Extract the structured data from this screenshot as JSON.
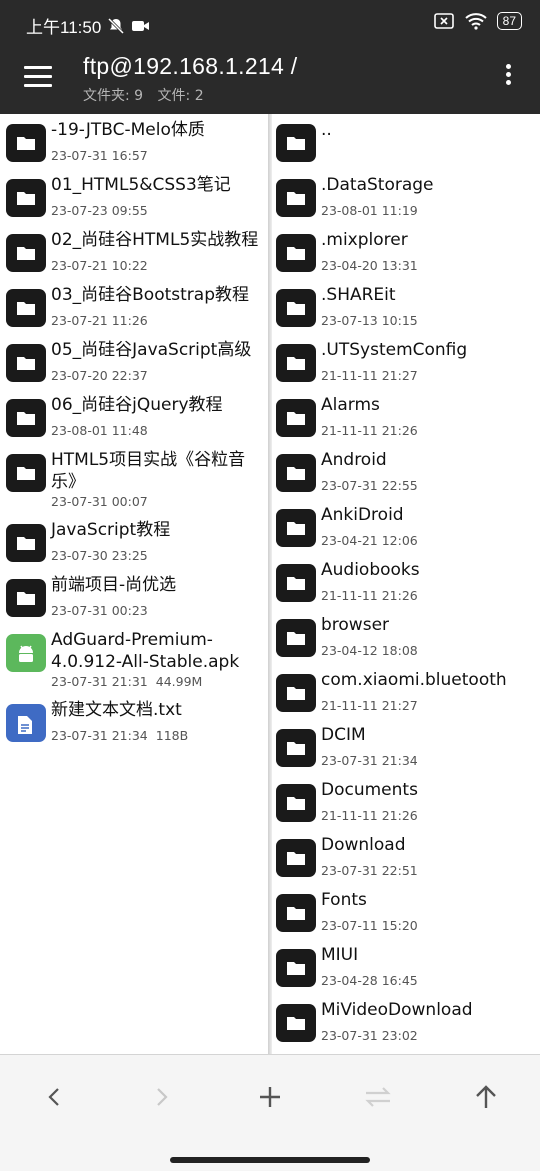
{
  "status_bar": {
    "time": "上午11:50",
    "battery": "87"
  },
  "app_bar": {
    "title": "ftp@192.168.1.214 /",
    "folders_label": "文件夹: 9",
    "files_label": "文件: 2"
  },
  "left_pane": [
    {
      "name": "-19-JTBC-Melo体质",
      "date": "23-07-31 16:57",
      "icon": "folder-icon"
    },
    {
      "name": "01_HTML5&CSS3笔记",
      "date": "23-07-23 09:55",
      "icon": "folder-icon"
    },
    {
      "name": "02_尚硅谷HTML5实战教程",
      "date": "23-07-21 10:22",
      "icon": "folder-icon"
    },
    {
      "name": "03_尚硅谷Bootstrap教程",
      "date": "23-07-21 11:26",
      "icon": "folder-icon"
    },
    {
      "name": "05_尚硅谷JavaScript高级",
      "date": "23-07-20 22:37",
      "icon": "folder-icon"
    },
    {
      "name": "06_尚硅谷jQuery教程",
      "date": "23-08-01 11:48",
      "icon": "folder-icon"
    },
    {
      "name": "HTML5项目实战《谷粒音乐》",
      "date": "23-07-31 00:07",
      "icon": "folder-icon"
    },
    {
      "name": "JavaScript教程",
      "date": "23-07-30 23:25",
      "icon": "folder-icon"
    },
    {
      "name": "前端项目-尚优选",
      "date": "23-07-31 00:23",
      "icon": "folder-icon"
    },
    {
      "name": "AdGuard-Premium-4.0.912-All-Stable.apk",
      "date": "23-07-31 21:31",
      "size": "44.99M",
      "icon": "android-icon"
    },
    {
      "name": "新建文本文档.txt",
      "date": "23-07-31 21:34",
      "size": "118B",
      "icon": "text-file-icon"
    }
  ],
  "right_pane": [
    {
      "name": "..",
      "date": ""
    },
    {
      "name": ".DataStorage",
      "date": "23-08-01 11:19"
    },
    {
      "name": ".mixplorer",
      "date": "23-04-20 13:31"
    },
    {
      "name": ".SHAREit",
      "date": "23-07-13 10:15"
    },
    {
      "name": ".UTSystemConfig",
      "date": "21-11-11 21:27"
    },
    {
      "name": "Alarms",
      "date": "21-11-11 21:26"
    },
    {
      "name": "Android",
      "date": "23-07-31 22:55"
    },
    {
      "name": "AnkiDroid",
      "date": "23-04-21 12:06"
    },
    {
      "name": "Audiobooks",
      "date": "21-11-11 21:26"
    },
    {
      "name": "browser",
      "date": "23-04-12 18:08"
    },
    {
      "name": "com.xiaomi.bluetooth",
      "date": "21-11-11 21:27"
    },
    {
      "name": "DCIM",
      "date": "23-07-31 21:34"
    },
    {
      "name": "Documents",
      "date": "21-11-11 21:26"
    },
    {
      "name": "Download",
      "date": "23-07-31 22:51"
    },
    {
      "name": "Fonts",
      "date": "23-07-11 15:20"
    },
    {
      "name": "MIUI",
      "date": "23-04-28 16:45"
    },
    {
      "name": "MiVideoDownload",
      "date": "23-07-31 23:02"
    }
  ],
  "bottom_bar": [
    "back-icon",
    "forward-icon",
    "add-icon",
    "swap-icon",
    "up-icon"
  ]
}
